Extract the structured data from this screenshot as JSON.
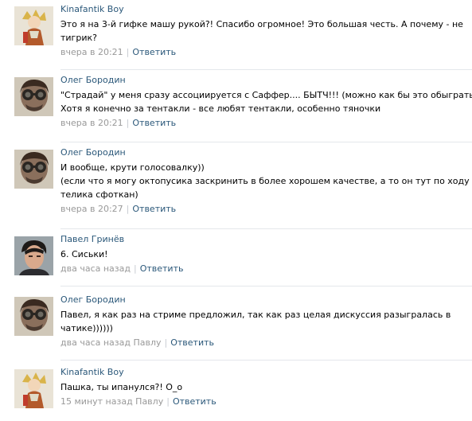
{
  "comments": [
    {
      "author": "Kinafantik Boy",
      "avatar": "anime-character-avatar",
      "lines": [
        "Это я на 3-й гифке машу рукой?! Спасибо огромное! Это большая честь. А почему - не",
        "тигрик?"
      ],
      "time": "вчера в 20:21",
      "reply_label": "Ответить"
    },
    {
      "author": "Олег Бородин",
      "avatar": "man-with-goggles-avatar",
      "lines": [
        "\"Страдай\" у меня сразу ассоциируется с Саффер.... БЫТЧ!!! (можно как бы это обыграть)",
        "Хотя я конечно за тентакли - все любят тентакли, особенно тяночки"
      ],
      "time": "вчера в 20:21",
      "reply_label": "Ответить"
    },
    {
      "author": "Олег Бородин",
      "avatar": "man-with-goggles-avatar",
      "lines": [
        "И вообще, крути голосовалку))",
        "(если что я могу октопусика заскринить в более хорошем качестве, а то он тут по ходу с",
        "телика сфоткан)"
      ],
      "time": "вчера в 20:27",
      "reply_label": "Ответить"
    },
    {
      "author": "Павел Гринёв",
      "avatar": "young-man-avatar",
      "lines": [
        "6. Сиськи!"
      ],
      "time": "два часа назад",
      "reply_label": "Ответить"
    },
    {
      "author": "Олег Бородин",
      "avatar": "man-with-goggles-avatar",
      "lines": [
        "Павел, я как раз на стриме предложил, так как раз целая дискуссия разыгралась в",
        "чатике))))))"
      ],
      "time": "два часа назад Павлу",
      "reply_label": "Ответить"
    },
    {
      "author": "Kinafantik Boy",
      "avatar": "anime-character-avatar",
      "lines": [
        "Пашка, ты ипанулся?! О_о"
      ],
      "time": "15 минут назад Павлу",
      "reply_label": "Ответить"
    }
  ],
  "colors": {
    "link": "#2b587a",
    "meta": "#999999",
    "divider": "#e4e7eb"
  }
}
